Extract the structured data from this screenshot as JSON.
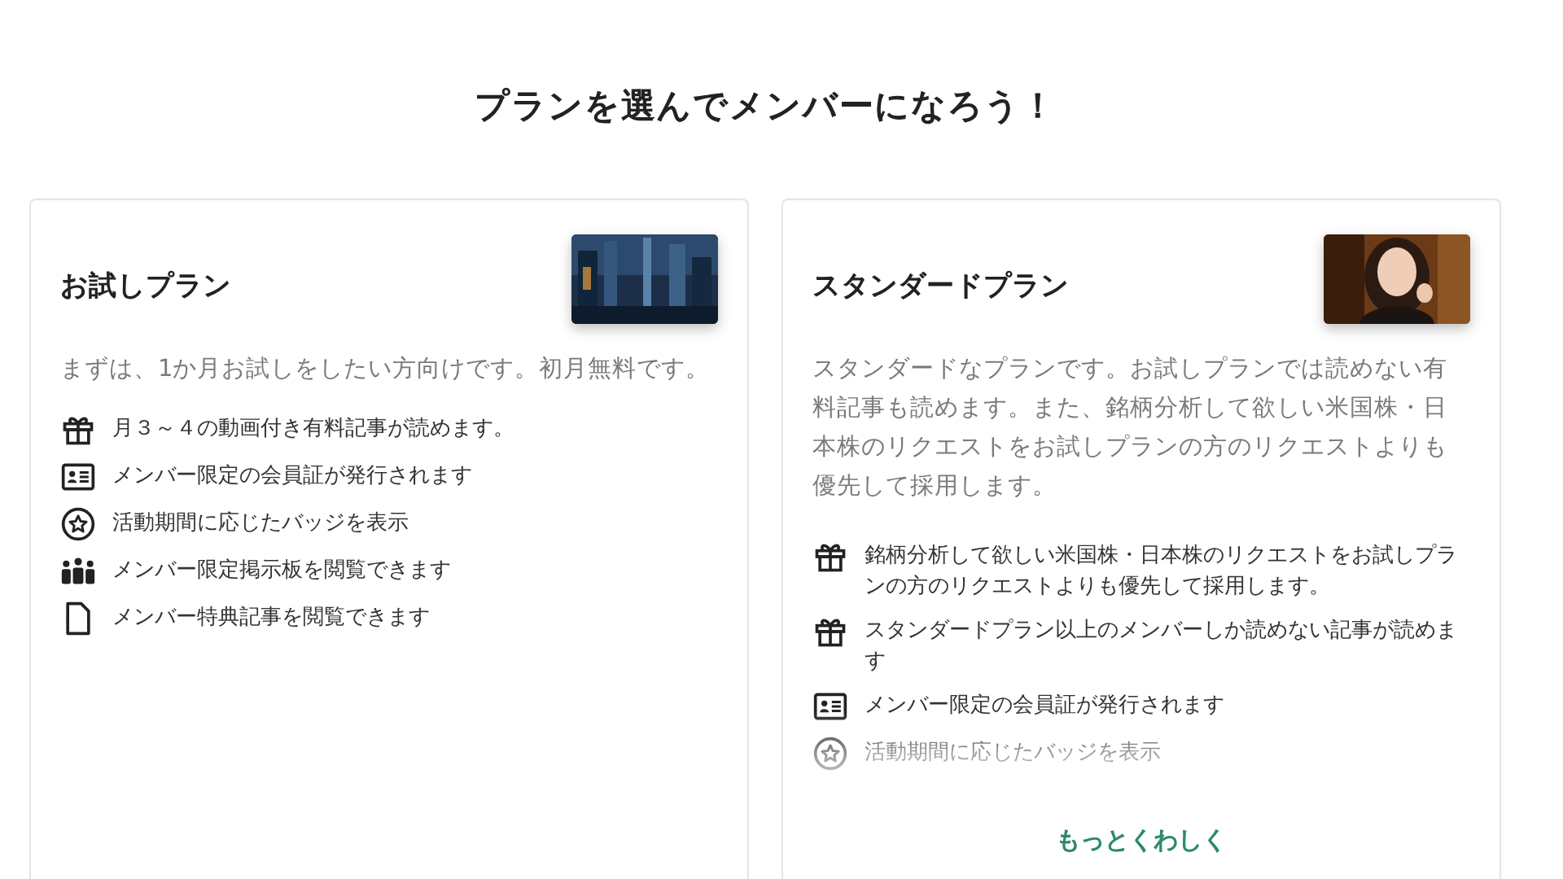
{
  "heading": "プランを選んでメンバーになろう！",
  "plans": [
    {
      "name": "お試しプラン",
      "thumbnail": {
        "kind": "picture"
      },
      "description": "まずは、1か月お試しをしたい方向けです。初月無料です。",
      "features": [
        {
          "kind": "gift",
          "text": "月３～４の動画付き有料記事が読めます。"
        },
        {
          "kind": "card",
          "text": "メンバー限定の会員証が発行されます"
        },
        {
          "kind": "badge",
          "text": "活動期間に応じたバッジを表示"
        },
        {
          "kind": "people",
          "text": "メンバー限定掲示板を閲覧できます"
        },
        {
          "kind": "document",
          "text": "メンバー特典記事を閲覧できます"
        }
      ]
    },
    {
      "name": "スタンダードプラン",
      "thumbnail": {
        "kind": "picture"
      },
      "description": "スタンダードなプランです。お試しプランでは読めない有料記事も読めます。また、銘柄分析して欲しい米国株・日本株のリクエストをお試しプランの方のリクエストよりも優先して採用します。",
      "features": [
        {
          "kind": "gift",
          "text": "銘柄分析して欲しい米国株・日本株のリクエストをお試しプランの方のリクエストよりも優先して採用します。"
        },
        {
          "kind": "gift",
          "text": "スタンダードプラン以上のメンバーしか読めない記事が読めます"
        },
        {
          "kind": "card",
          "text": "メンバー限定の会員証が発行されます"
        },
        {
          "kind": "badge",
          "text": "活動期間に応じたバッジを表示"
        }
      ],
      "more_link": "もっとくわしく"
    }
  ]
}
